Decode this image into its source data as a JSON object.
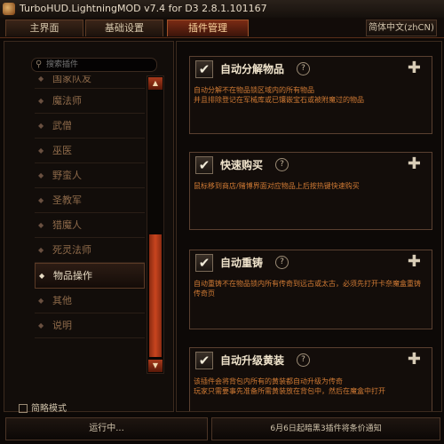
{
  "window": {
    "title": "TurboHUD.LightningMOD v7.4 for D3 2.8.1.101167"
  },
  "tabs": [
    {
      "label": "主界面"
    },
    {
      "label": "基础设置"
    },
    {
      "label": "插件管理"
    }
  ],
  "language_button": "简体中文(zhCN)",
  "search": {
    "placeholder": "搜索插件"
  },
  "sidebar": {
    "items": [
      {
        "label": "国家队友"
      },
      {
        "label": "魔法师"
      },
      {
        "label": "武僧"
      },
      {
        "label": "巫医"
      },
      {
        "label": "野蛮人"
      },
      {
        "label": "圣教军"
      },
      {
        "label": "猎魔人"
      },
      {
        "label": "死灵法师"
      },
      {
        "label": "物品操作"
      },
      {
        "label": "其他"
      },
      {
        "label": "说明"
      }
    ],
    "active_index": 8,
    "compact_mode_label": "简略模式"
  },
  "plugins": [
    {
      "title": "自动分解物品",
      "desc": "自动分解不在物品锁区域内的所有物品\n并且排除登记在军械库或已镶嵌宝石或被附魔过的物品"
    },
    {
      "title": "快速购买",
      "desc": "鼠标移到商店/赌博界面对应物品上后按热键快速购买"
    },
    {
      "title": "自动重铸",
      "desc": "自动重铸不在物品锁内所有传奇到远古或太古，必须先打开卡奈魔盒重铸传奇页"
    },
    {
      "title": "自动升级黄装",
      "desc": "该插件会将背包内所有的黄装都自动升级为传奇\n玩家只需要事先准备所需黄装放在背包中，然后在魔盒中打开"
    }
  ],
  "status": {
    "left": "运行中...",
    "right": "6月6日起暗黑3插件将条价通知"
  },
  "icons": {
    "checkbox": "check-icon",
    "help": "help-circle-icon",
    "plus": "plus-icon",
    "search": "search-icon",
    "scroll_up": "arrow-up-icon",
    "scroll_down": "arrow-down-icon"
  }
}
